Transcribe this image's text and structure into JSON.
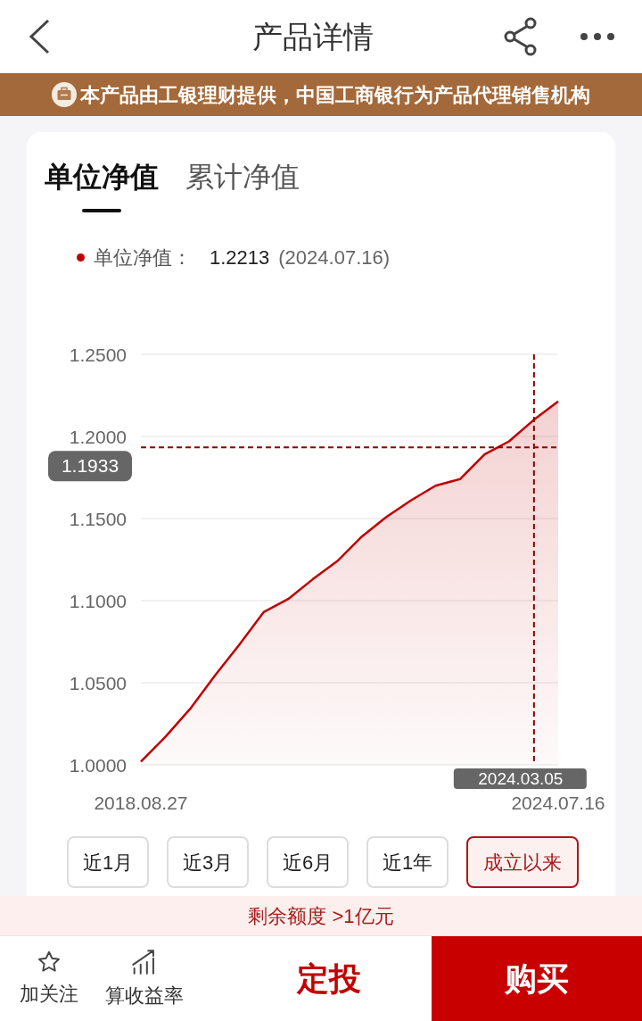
{
  "header": {
    "title": "产品详情"
  },
  "banner": {
    "text": "本产品由工银理财提供，中国工商银行为产品代理销售机构"
  },
  "tabs": [
    {
      "label": "单位净值",
      "selected": true
    },
    {
      "label": "累计净值",
      "selected": false
    }
  ],
  "legend": {
    "colon": "：",
    "value": "1.2213",
    "date": "(2024.07.16)"
  },
  "chart": {
    "chart_data": {
      "type": "area",
      "grid": true,
      "categories": [
        "2018.08.27",
        null,
        null,
        null,
        null,
        null,
        null,
        null,
        null,
        null,
        null,
        null,
        null,
        null,
        null,
        null,
        null,
        "2024.07.16"
      ],
      "series": [
        {
          "name": "单位净值",
          "color": "#c00000",
          "values": [
            1.002,
            1.017,
            1.034,
            1.054,
            1.073,
            1.093,
            1.101,
            1.113,
            1.124,
            1.139,
            1.151,
            1.161,
            1.17,
            1.174,
            1.189,
            1.197,
            1.21,
            1.2213
          ]
        }
      ],
      "ylim": [
        1,
        1.25
      ],
      "yticks": [
        {
          "value": 1,
          "label": "1.0000"
        },
        {
          "value": 1.05,
          "label": "1.0500"
        },
        {
          "value": 1.1,
          "label": "1.1000"
        },
        {
          "value": 1.15,
          "label": "1.1500"
        },
        {
          "value": 1.2,
          "label": "1.2000"
        },
        {
          "value": 1.25,
          "label": "1.2500"
        }
      ],
      "ref_lines": [
        {
          "axis": "y",
          "value": 1.1933,
          "label": "1.1933"
        }
      ],
      "annotations": [
        "2024.03.05"
      ]
    }
  },
  "ranges": [
    {
      "label": "近1月",
      "selected": false
    },
    {
      "label": "近3月",
      "selected": false
    },
    {
      "label": "近6月",
      "selected": false
    },
    {
      "label": "近1年",
      "selected": false
    },
    {
      "label": "成立以来",
      "selected": true
    }
  ],
  "quota": "剩余额度 >1亿元",
  "bottom_bar": {
    "actions": [
      {
        "label": "加关注",
        "kind": "star"
      },
      {
        "label": "算收益率",
        "kind": "chart"
      }
    ],
    "plan_button": "定投",
    "buy_button": "购买"
  }
}
